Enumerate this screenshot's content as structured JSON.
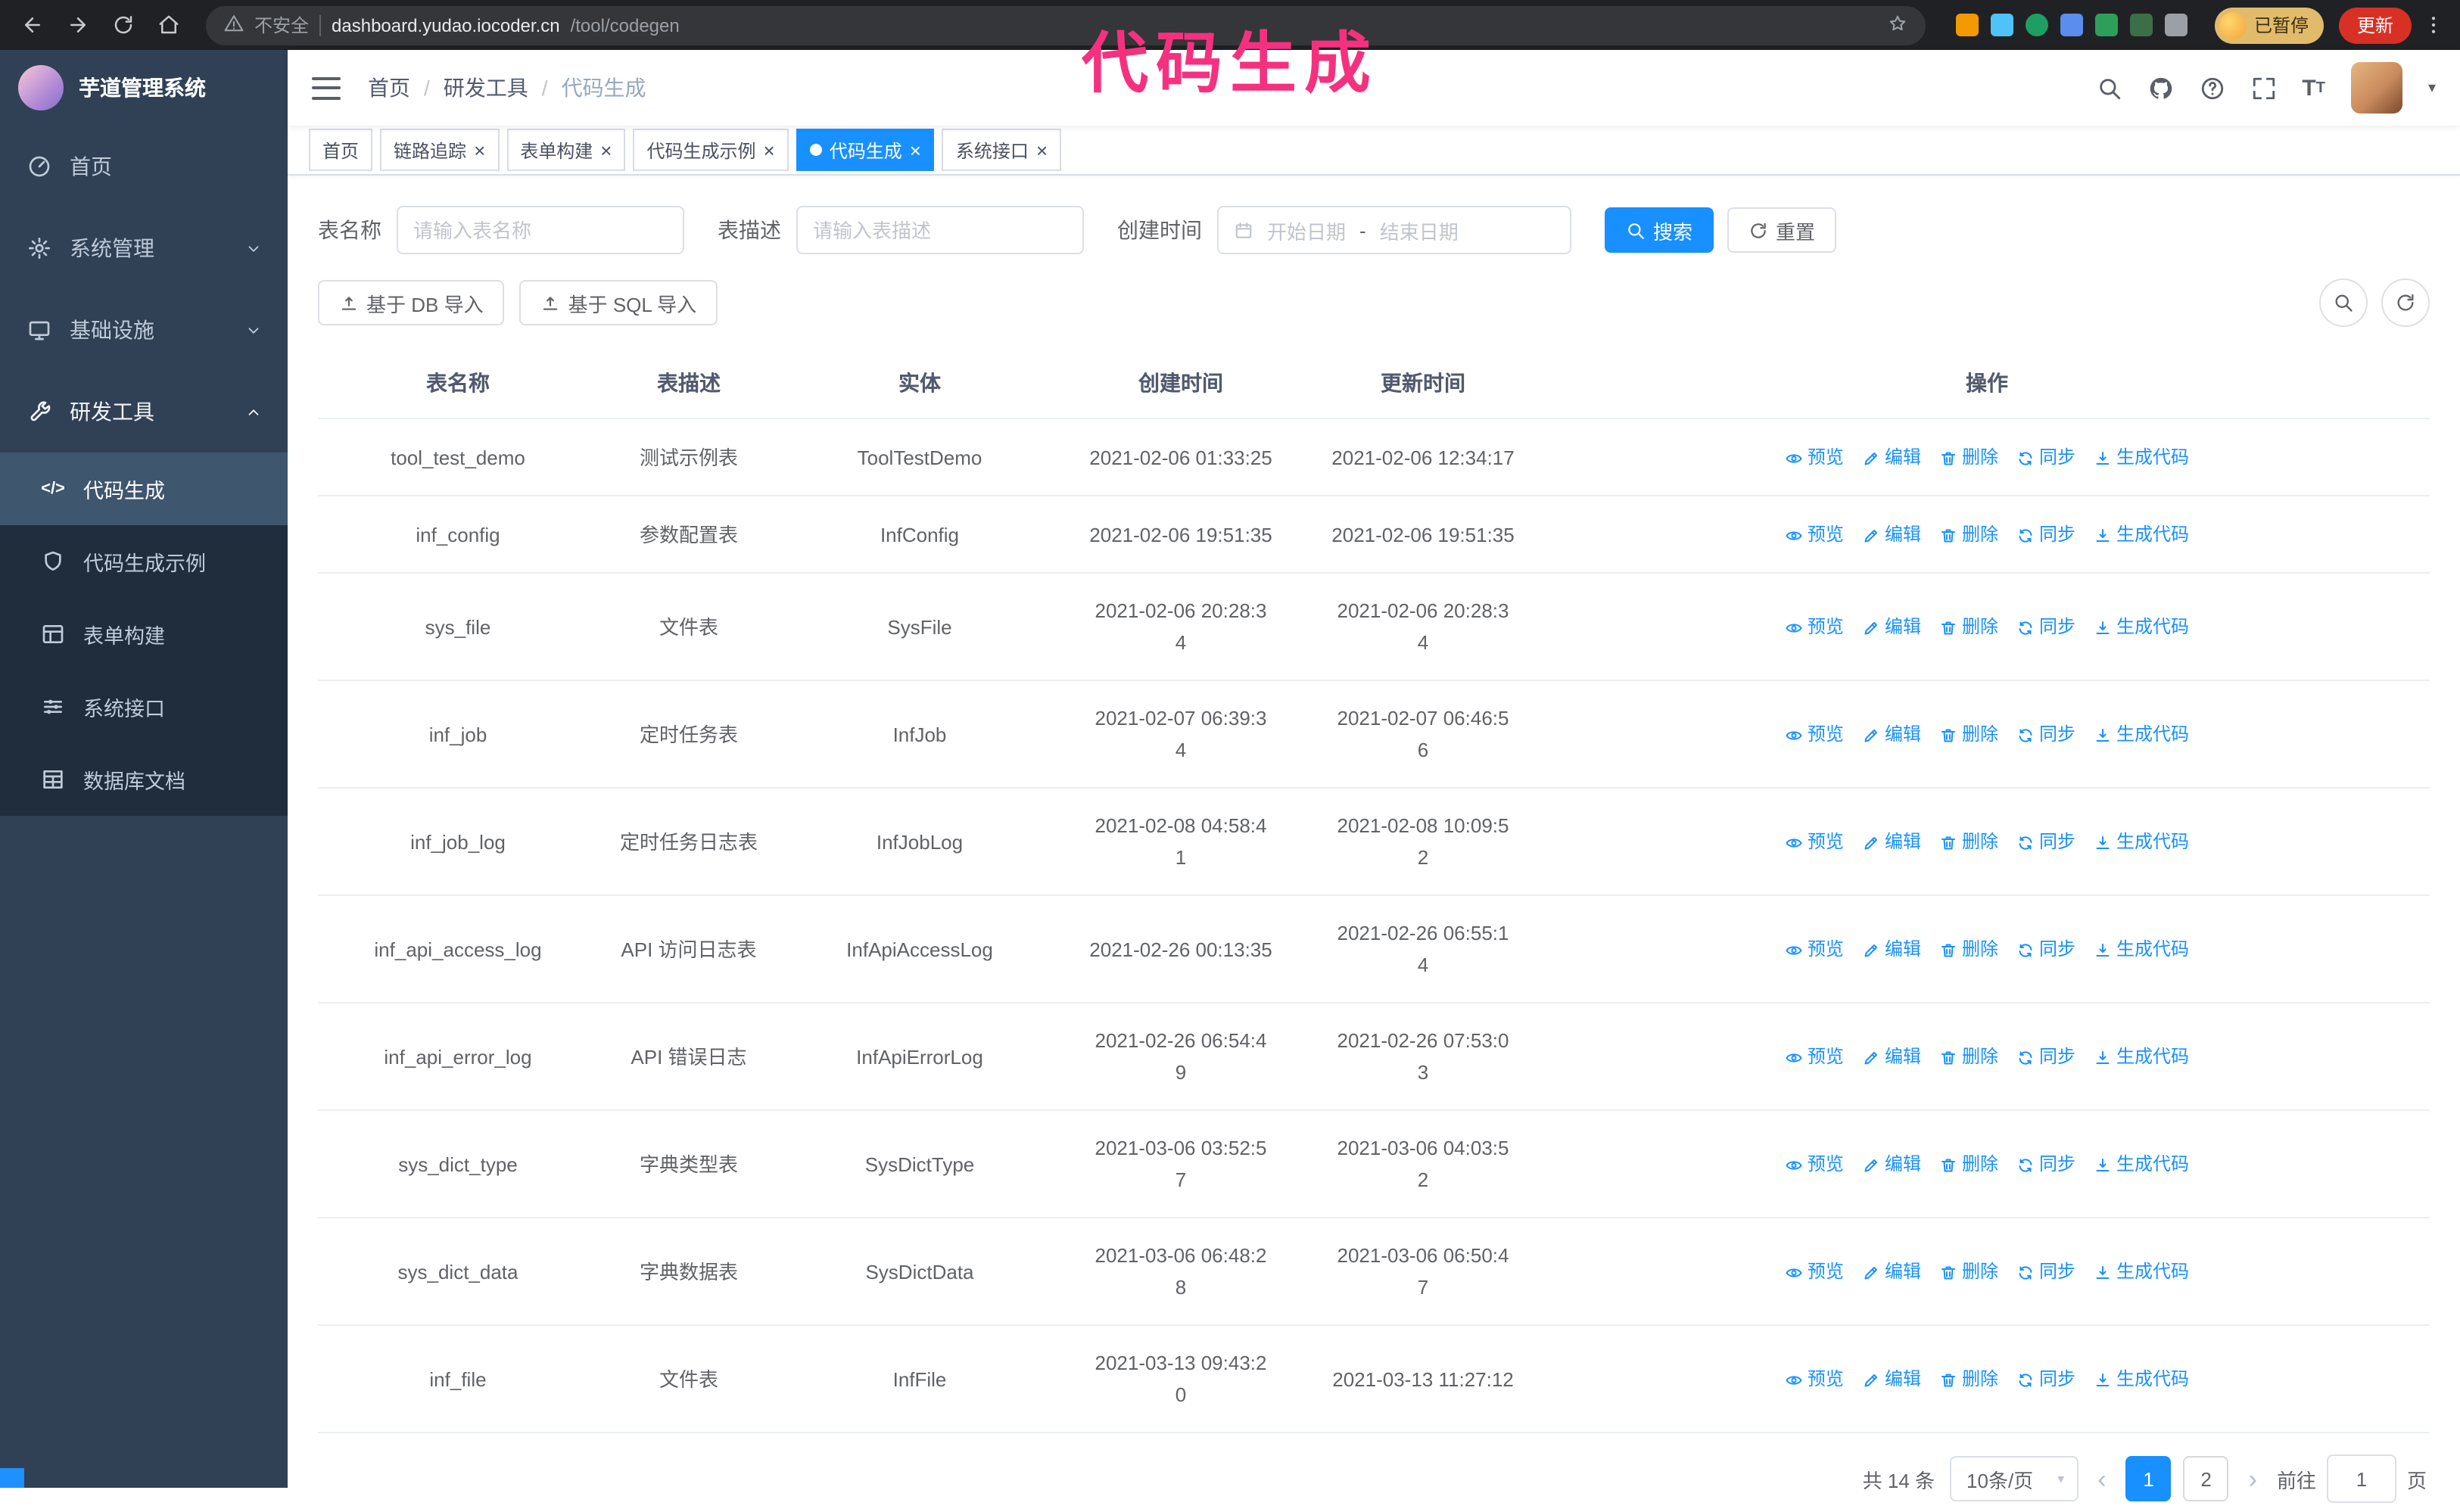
{
  "annotation": "代码生成",
  "colors": {
    "primary": "#1890ff",
    "sidebar_bg": "#304156",
    "submenu_bg": "#1f2d3d",
    "annotation": "#f5317f",
    "update_button": "#d93025"
  },
  "browser": {
    "nav_icons": [
      "back",
      "forward",
      "reload",
      "home"
    ],
    "security_label": "不安全",
    "url_domain": "dashboard.yudao.iocoder.cn",
    "url_path": "/tool/codegen",
    "extensions": [
      {
        "name": "extension-orange",
        "color": "#f29900"
      },
      {
        "name": "extension-drop",
        "color": "#4fc3f7"
      },
      {
        "name": "extension-green-v",
        "color": "#1e9e63",
        "shape": "circle"
      },
      {
        "name": "extension-people",
        "color": "#5b8def"
      },
      {
        "name": "extension-card",
        "color": "#2e9e5b"
      },
      {
        "name": "extension-leaf",
        "color": "#3c6e47"
      },
      {
        "name": "extension-puzzle",
        "color": "#9aa0a6"
      }
    ],
    "paused_badge": "已暂停",
    "update_button": "更新"
  },
  "sidebar": {
    "logo_title": "芋道管理系统",
    "items": [
      {
        "id": "home",
        "label": "首页",
        "icon": "dashboard",
        "type": "top"
      },
      {
        "id": "system",
        "label": "系统管理",
        "icon": "gear",
        "type": "top",
        "chevron": "down"
      },
      {
        "id": "infra",
        "label": "基础设施",
        "icon": "monitor",
        "type": "top",
        "chevron": "down"
      },
      {
        "id": "devtools",
        "label": "研发工具",
        "icon": "tools",
        "type": "top",
        "chevron": "up",
        "active": true
      },
      {
        "id": "codegen",
        "label": "代码生成",
        "icon": "code",
        "type": "sub",
        "selected": true
      },
      {
        "id": "codegen-demo",
        "label": "代码生成示例",
        "icon": "badge",
        "type": "sub"
      },
      {
        "id": "form-builder",
        "label": "表单构建",
        "icon": "form",
        "type": "sub"
      },
      {
        "id": "api",
        "label": "系统接口",
        "icon": "sliders",
        "type": "sub"
      },
      {
        "id": "db-doc",
        "label": "数据库文档",
        "icon": "dbtable",
        "type": "sub"
      }
    ]
  },
  "header": {
    "breadcrumb": [
      "首页",
      "研发工具",
      "代码生成"
    ],
    "separator": "/",
    "icons": [
      "search",
      "github",
      "question",
      "fullscreen",
      "fontsize"
    ]
  },
  "tabs": [
    {
      "id": "home",
      "label": "首页",
      "closable": false,
      "active": false
    },
    {
      "id": "trace",
      "label": "链路追踪",
      "closable": true,
      "active": false
    },
    {
      "id": "form-builder",
      "label": "表单构建",
      "closable": true,
      "active": false
    },
    {
      "id": "codegen-demo",
      "label": "代码生成示例",
      "closable": true,
      "active": false
    },
    {
      "id": "codegen",
      "label": "代码生成",
      "closable": true,
      "active": true
    },
    {
      "id": "api",
      "label": "系统接口",
      "closable": true,
      "active": false
    }
  ],
  "filters": {
    "table_name_label": "表名称",
    "table_name_placeholder": "请输入表名称",
    "table_desc_label": "表描述",
    "table_desc_placeholder": "请输入表描述",
    "create_time_label": "创建时间",
    "date_start_placeholder": "开始日期",
    "date_separator": "-",
    "date_end_placeholder": "结束日期",
    "search_button": "搜索",
    "reset_button": "重置"
  },
  "toolbar": {
    "import_db": "基于 DB 导入",
    "import_sql": "基于 SQL 导入"
  },
  "table": {
    "columns": [
      "表名称",
      "表描述",
      "实体",
      "创建时间",
      "更新时间",
      "操作"
    ],
    "actions": [
      {
        "id": "preview",
        "label": "预览",
        "icon": "eye"
      },
      {
        "id": "edit",
        "label": "编辑",
        "icon": "edit"
      },
      {
        "id": "delete",
        "label": "删除",
        "icon": "del"
      },
      {
        "id": "sync",
        "label": "同步",
        "icon": "sync"
      },
      {
        "id": "generate",
        "label": "生成代码",
        "icon": "download"
      }
    ],
    "rows": [
      {
        "name": "tool_test_demo",
        "desc": "测试示例表",
        "entity": "ToolTestDemo",
        "created": "2021-02-06 01:33:25",
        "updated": "2021-02-06 12:34:17"
      },
      {
        "name": "inf_config",
        "desc": "参数配置表",
        "entity": "InfConfig",
        "created": "2021-02-06 19:51:35",
        "updated": "2021-02-06 19:51:35"
      },
      {
        "name": "sys_file",
        "desc": "文件表",
        "entity": "SysFile",
        "created": "2021-02-06 20:28:3\n4",
        "updated": "2021-02-06 20:28:3\n4"
      },
      {
        "name": "inf_job",
        "desc": "定时任务表",
        "entity": "InfJob",
        "created": "2021-02-07 06:39:3\n4",
        "updated": "2021-02-07 06:46:5\n6"
      },
      {
        "name": "inf_job_log",
        "desc": "定时任务日志表",
        "entity": "InfJobLog",
        "created": "2021-02-08 04:58:4\n1",
        "updated": "2021-02-08 10:09:5\n2"
      },
      {
        "name": "inf_api_access_log",
        "desc": "API 访问日志表",
        "entity": "InfApiAccessLog",
        "created": "2021-02-26 00:13:35",
        "updated": "2021-02-26 06:55:1\n4"
      },
      {
        "name": "inf_api_error_log",
        "desc": "API 错误日志",
        "entity": "InfApiErrorLog",
        "created": "2021-02-26 06:54:4\n9",
        "updated": "2021-02-26 07:53:0\n3"
      },
      {
        "name": "sys_dict_type",
        "desc": "字典类型表",
        "entity": "SysDictType",
        "created": "2021-03-06 03:52:5\n7",
        "updated": "2021-03-06 04:03:5\n2"
      },
      {
        "name": "sys_dict_data",
        "desc": "字典数据表",
        "entity": "SysDictData",
        "created": "2021-03-06 06:48:2\n8",
        "updated": "2021-03-06 06:50:4\n7"
      },
      {
        "name": "inf_file",
        "desc": "文件表",
        "entity": "InfFile",
        "created": "2021-03-13 09:43:2\n0",
        "updated": "2021-03-13 11:27:12"
      }
    ]
  },
  "pagination": {
    "total": "共 14 条",
    "page_size": "10条/页",
    "pages": [
      "1",
      "2"
    ],
    "active_page": "1",
    "goto_label": "前往",
    "goto_value": "1",
    "goto_suffix": "页"
  }
}
